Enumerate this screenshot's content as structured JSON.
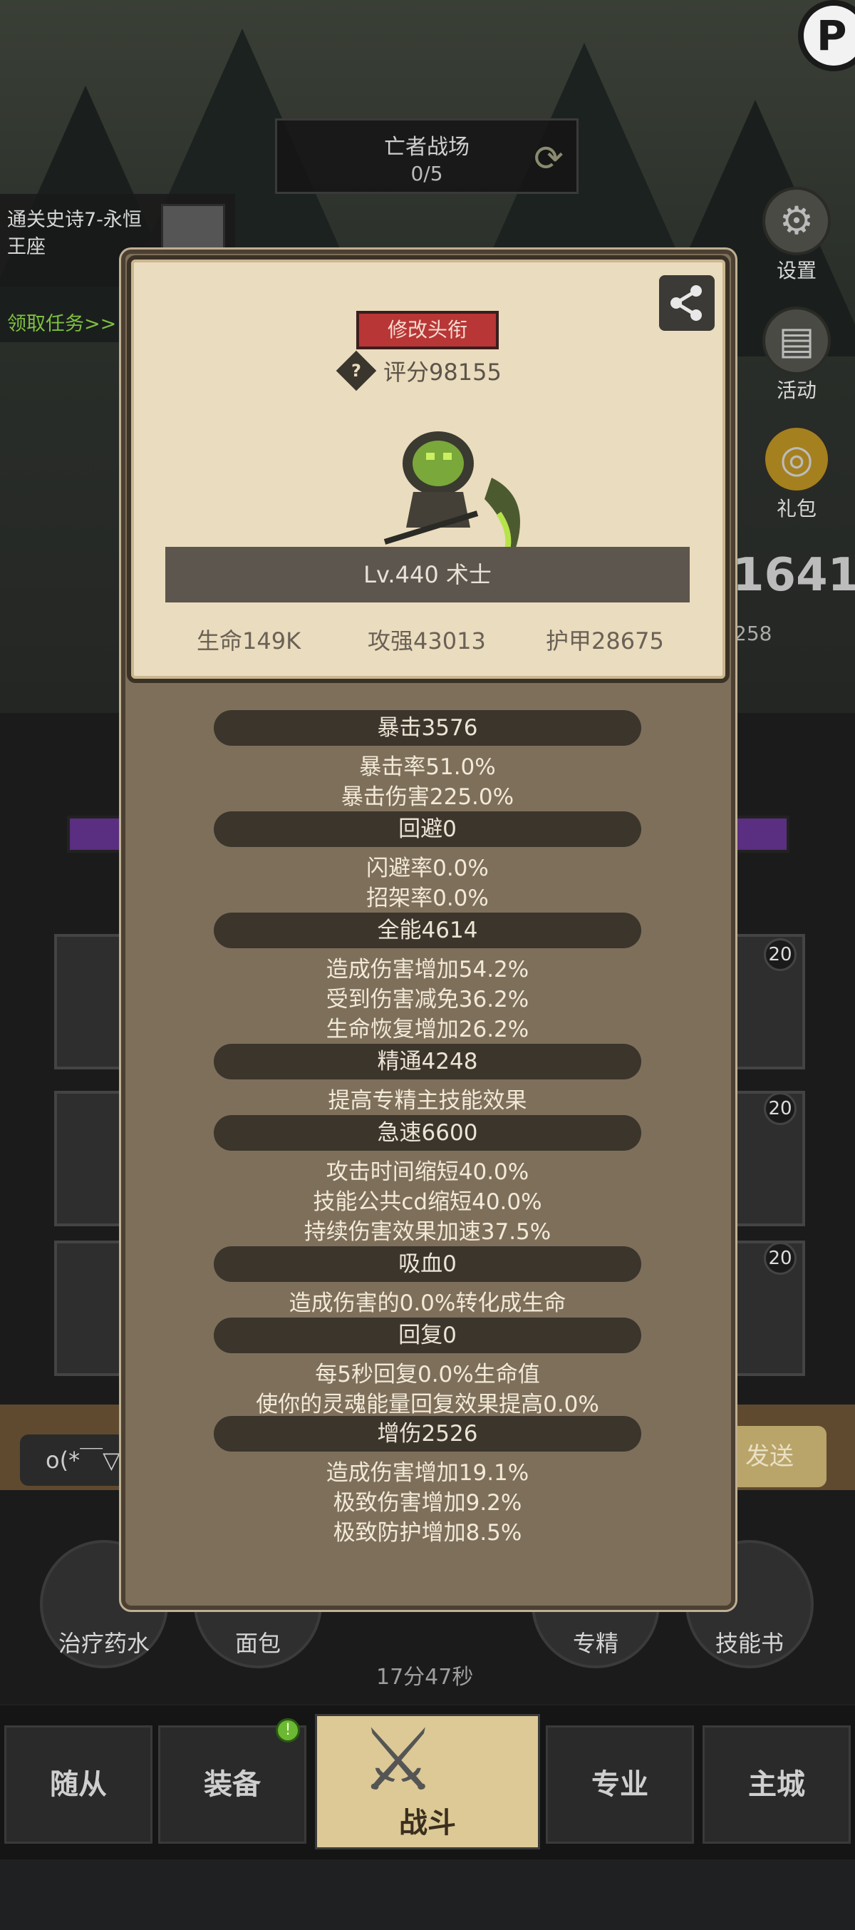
{
  "background": {
    "battle_title": "亡者战场",
    "battle_progress": "0/5",
    "quest_name": "通关史诗7-永恒王座",
    "quest_link": "领取任务>>",
    "side_buttons": [
      "设置",
      "活动",
      "礼包"
    ],
    "big_number": "1641",
    "small_number": "258",
    "slot_badges": [
      "20",
      "20",
      "20"
    ],
    "chat_input": "o(*￣▽",
    "chat_send": "发送",
    "items": [
      "治疗药水",
      "面包",
      "专精",
      "技能书"
    ],
    "timer": "17分47秒",
    "nav_tabs": [
      "随从",
      "装备",
      "战斗",
      "专业",
      "主城"
    ],
    "logo_letter": "P"
  },
  "card": {
    "edit_title_button": "修改头衔",
    "score": "评分98155",
    "level_text": "Lv.440 术士",
    "hp": "生命149K",
    "attack": "攻强43013",
    "armor": "护甲28675"
  },
  "sections": [
    {
      "title": "暴击3576",
      "lines": [
        "暴击率51.0%",
        "暴击伤害225.0%"
      ]
    },
    {
      "title": "回避0",
      "lines": [
        "闪避率0.0%",
        "招架率0.0%"
      ]
    },
    {
      "title": "全能4614",
      "lines": [
        "造成伤害增加54.2%",
        "受到伤害减免36.2%",
        "生命恢复增加26.2%"
      ]
    },
    {
      "title": "精通4248",
      "lines": [
        "提高专精主技能效果"
      ]
    },
    {
      "title": "急速6600",
      "lines": [
        "攻击时间缩短40.0%",
        "技能公共cd缩短40.0%",
        "持续伤害效果加速37.5%"
      ]
    },
    {
      "title": "吸血0",
      "lines": [
        "造成伤害的0.0%转化成生命"
      ]
    },
    {
      "title": "回复0",
      "lines": [
        "每5秒回复0.0%生命值",
        "使你的灵魂能量回复效果提高0.0%"
      ]
    },
    {
      "title": "增伤2526",
      "lines": [
        "造成伤害增加19.1%",
        "极致伤害增加9.2%",
        "极致防护增加8.5%"
      ]
    }
  ],
  "colors": {
    "panel": "#7e6f5b",
    "card": "#eadcbe",
    "band": "#3b352c",
    "red_button": "#b83636",
    "quest_green": "#7fbf3f"
  }
}
